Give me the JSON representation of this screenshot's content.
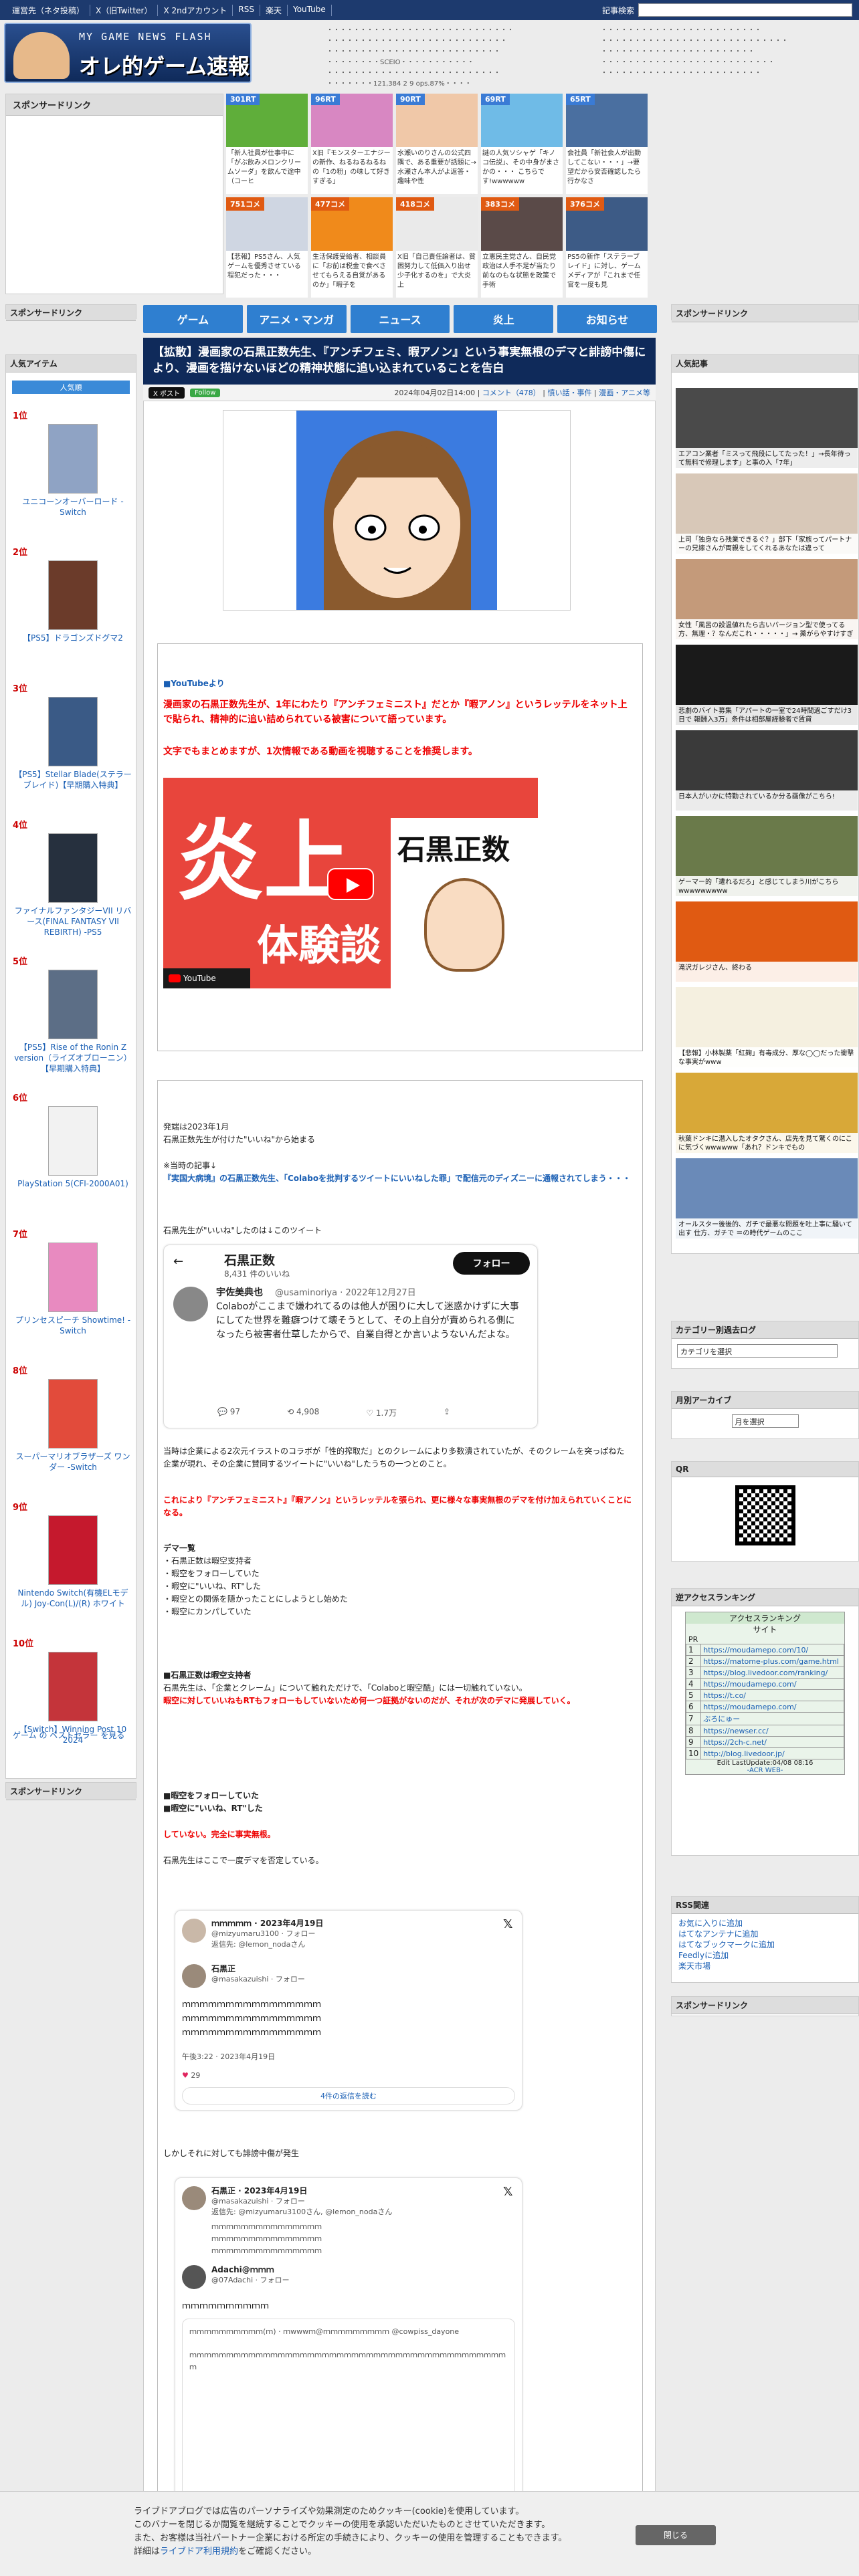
{
  "topbar": {
    "links": [
      "運営先（ネタ投稿）",
      "X（旧Twitter）",
      "X 2ndアカウント",
      "RSS",
      "楽天",
      "YouTube"
    ],
    "search_label": "記事検索"
  },
  "logo": {
    "sub": "MY GAME NEWS FLASH",
    "main": "オレ的ゲーム速報@JIN"
  },
  "headlinks": {
    "left": [
      "・・・・・・・・・・・・・・・・・・・・・・・・・・・・",
      "・・・・・・・・・・・・・・・・・・・・・・・・・・・",
      "・・・・・・・・・・・・・・・・・・・・・・・・・・",
      "・・・・・・・・SCEIO・・・・・・・・・・・",
      "・・・・・・・・・・・・・・・・・・・・・・・・・・",
      "・・・・・・・121,384 2 9 ops.87%・・・・"
    ],
    "right": [
      "・・・・・・・・・・・・・・・・・・・・・・・・",
      "・・・・・・・・・・・・・・・・・・・・・・・・・・・・",
      "・・・・・・・・・・・・・・・・・・・・・・・",
      "・・・・・・・・・・・・・・・・・・・・・・・・・・",
      "・・・・・・・・・・・・・・・・・・・・・・・・"
    ]
  },
  "sponsor_label": "スポンサードリンク",
  "tiles": [
    {
      "badge": "301RT",
      "red": false,
      "cap": "「新人社員が仕事中に「がぶ飲みメロンクリームソーダ」を飲んで途中（コーヒ",
      "color": "#5fae3a"
    },
    {
      "badge": "96RT",
      "red": false,
      "cap": "X旧『モンスターエナジーの新作、ねるねるねるねの「1の粉」の味して好きすぎる」",
      "color": "#d887c2"
    },
    {
      "badge": "90RT",
      "red": false,
      "cap": "水瀬いのりさんの公式四隅で、ある重要が話題に→水瀬さん本人がよ返答・趣味や性",
      "color": "#f0c8a8"
    },
    {
      "badge": "69RT",
      "red": false,
      "cap": "謎の人気ソシャゲ「キノコ伝説」、その中身がまさかの・・・ こちらです!wwwwww",
      "color": "#6fbbe7"
    },
    {
      "badge": "65RT",
      "red": false,
      "cap": "会社員「新社会人が出勤してこない・・・」→要望だから安否確認したら行かなさ",
      "color": "#4a6fa0"
    },
    {
      "badge": "751コメ",
      "red": true,
      "cap": "【悲報】PS5さん、人気ゲームを優秀させている程犯だった・・・",
      "color": "#cfd6e2"
    },
    {
      "badge": "477コメ",
      "red": true,
      "cap": "生活保護受給者、相談員に「お前は税金で食べさせてもらえる自覚があるのか」「暇子を",
      "color": "#f08a1b"
    },
    {
      "badge": "418コメ",
      "red": true,
      "cap": "X旧「自己責任論者は、貧困努力して低価入り出せ少子化するのを」で大炎上",
      "color": "#eaeaea"
    },
    {
      "badge": "383コメ",
      "red": true,
      "cap": "立憲民主党さん、自民党政治は人手不足が当たり前なのもな状態を政策で手術",
      "color": "#5a4a48"
    },
    {
      "badge": "376コメ",
      "red": true,
      "cap": "PS5の新作「ステラーブレイド」に対し、ゲームメディアが『これまで任官を一度も見",
      "color": "#3d5b86"
    }
  ],
  "nav": [
    "ゲーム",
    "アニメ・マンガ",
    "ニュース",
    "炎上",
    "お知らせ"
  ],
  "article": {
    "title": "【拡散】漫画家の石黒正数先生、『アンチフェミ、暇アノン』という事実無根のデマと誹謗中傷により、漫画を描けないほどの精神状態に追い込まれていることを告白",
    "post_btn": "X ポスト",
    "follow_btn": "Follow",
    "date": "2024年04月02日14:00",
    "comments": "コメント（478）",
    "cat1": "憤い話・事件",
    "cat2": "漫画・アニメ等",
    "yt_label": "■YouTubeより",
    "red1": "漫画家の石黒正数先生が、1年にわたり『アンチフェミニスト』だとか『暇アノン』というレッテルをネット上で貼られ、精神的に追い詰められている被害について語っています。",
    "red2": "文字でもまとめますが、1次情報である動画を視聴することを推奨します。",
    "video_big": "炎上",
    "video_sub": "体験談",
    "video_name": "石黒正数",
    "yt_brand": "YouTube",
    "p1a": "発端は2023年1月",
    "p1b": "石黒正数先生が付けた\"いいね\"から始まる",
    "p2a": "※当時の記事↓",
    "p2b": "『実国大病境』の石黒正数先生、「Colaboを批判するツイートにいいねした罪」で配信元のディズニーに通報されてしまう・・・",
    "p3": "石黒先生が\"いいね\"したのは↓このツイート",
    "tw1_name": "石黒正数",
    "tw1_follow": "フォロー",
    "tw1_likes": "8,431 件のいいね",
    "tw1_user": "宇佐美典也",
    "tw1_handle": "@usaminoriya · 2022年12月27日",
    "tw1_text": "Colaboがここまで嫌われてるのは他人が困りに大して迷惑かけずに大事にしてた世界を難癖つけて壊そうとして、その上自分が責められる側になったら被害者仕草したからで、自業自得とか言いようないんだよな。",
    "tw1_reply": "97",
    "tw1_rt": "4,908",
    "tw1_like": "1.7万",
    "p4": "当時は企業による2次元イラストのコラボが「性的搾取だ」とのクレームにより多数潰されていたが、そのクレームを突っぱねた企業が現れ、その企業に賛同するツイートに\"いいね\"したうちの一つとのこと。",
    "p5": "これにより『アンチフェミニスト』『暇アノン』というレッテルを張られ、更に様々な事実無根のデマを付け加えられていくことになる。",
    "demo_h": "デマ一覧",
    "demo": [
      "・石黒正数は暇空支持者",
      "・暇空をフォローしていた",
      "・暇空に\"いいね、RT\"した",
      "・暇空との関係を隠かったことにしようとし始めた",
      "・暇空にカンパしていた"
    ],
    "p6h": "■石黒正数は暇空支持者",
    "p6": "石黒先生は、「企業とクレーム」について触れただけで、「Colaboと暇空酷」には一切触れていない。",
    "p6red": "暇空に対していいねもRTもフォローもしていないため何一つ証拠がないのだが、それが次のデマに発展していく。",
    "p7h1": "■暇空をフォローしていた",
    "p7h2": "■暇空に\"いいね、RT\"した",
    "p7red": "していない。完全に事実無根。",
    "p8": "石黒先生はここで一度デマを否定している。",
    "tw2_name": "ｍｍｍｍｍ · 2023年4月19日",
    "tw2_handle": "@mizyumaru3100 · フォロー",
    "tw2_reply": "返信先: @lemon_nodaさん",
    "tw2_user": "石黒正",
    "tw2_uhandle": "@masakazuishi · フォロー",
    "tw2_lines": [
      "ｍｍｍｍｍｍｍｍｍｍｍｍｍｍｍｍ",
      "ｍｍｍｍｍｍｍｍｍｍｍｍｍｍｍｍ",
      "ｍｍｍｍｍｍｍｍｍｍｍｍｍｍｍｍ"
    ],
    "tw2_time": "午後3:22 · 2023年4月19日",
    "tw2_likes": "29",
    "tw2_more": "4件の返信を読む",
    "p9": "しかしそれに対しても誹謗中傷が発生",
    "tw3_name": "石黒正 · 2023年4月19日",
    "tw3_handle": "@masakazuishi · フォロー",
    "tw3_reply": "返信先: @mizyumaru3100さん, @lemon_nodaさん",
    "tw3_lines": [
      "ｍｍｍｍｍｍｍｍｍｍｍｍｍｍｍ",
      "ｍｍｍｍｍｍｍｍｍｍｍｍｍｍｍ",
      "ｍｍｍｍｍｍｍｍｍｍｍｍｍｍｍ"
    ],
    "tw3_user": "Adachi@ｍｍｍ",
    "tw3_uhandle": "@07Adachi · フォロー",
    "tw3_body": "ｍｍｍｍｍｍｍｍｍｍ",
    "tw3_quote": "ｍｍｍｍｍｍｍｍｍｍ(ｍ) · ｍwwwｍ@ｍｍｍｍｍｍｍｍｍ @cowpiss_dayone",
    "tw3_qtext": "ｍｍｍｍｍｍｍｍｍｍｍｍｍｍｍｍｍｍｍｍｍｍｍｍｍｍｍｍｍｍｍｍｍｍｍｍｍｍｍｍｍｍｍｍ"
  },
  "left": {
    "popular": "人気アイテム",
    "tab": "人気順",
    "ranks": [
      {
        "num": "1位",
        "tx": "ユニコーンオーバーロード -Switch",
        "color": "#8fa3c4"
      },
      {
        "num": "2位",
        "tx": "【PS5】ドラゴンズドグマ2",
        "color": "#6b3b2a"
      },
      {
        "num": "3位",
        "tx": "【PS5】Stellar Blade(ステラーブレイド)【早期購入特典】",
        "color": "#3a5a86"
      },
      {
        "num": "4位",
        "tx": "ファイナルファンタジーVII リバース(FINAL FANTASY VII REBIRTH) -PS5",
        "color": "#26303e"
      },
      {
        "num": "5位",
        "tx": "【PS5】Rise of the Ronin Z version（ライズオブローニン）【早期購入特典】",
        "color": "#5c6e86"
      },
      {
        "num": "6位",
        "tx": "PlayStation 5(CFI-2000A01)",
        "color": "#f2f2f2"
      },
      {
        "num": "7位",
        "tx": "プリンセスピーチ Showtime! -Switch",
        "color": "#e88ac0"
      },
      {
        "num": "8位",
        "tx": "スーパーマリオブラザーズ ワンダー -Switch",
        "color": "#e24b3b"
      },
      {
        "num": "9位",
        "tx": "Nintendo Switch(有機ELモデル) Joy-Con(L)/(R) ホワイト",
        "color": "#c5192d"
      },
      {
        "num": "10位",
        "tx": "【Switch】Winning Post 10 2024",
        "color": "#c4343a"
      }
    ],
    "more": "ゲーム の ベストセラー を見る"
  },
  "right": {
    "popular": "人気記事",
    "items": [
      {
        "cap": "エアコン業者「ミスって飛段にしてたった！」→長年待って無料で修理します」と事の入「7年」",
        "c": "#4a4a4a"
      },
      {
        "cap": "上司「独身なら残業できるぐ？」部下「家族ってパートナーの兄嫁さんが両親をしてくれるあなたは違って",
        "c": "#d8c8b8"
      },
      {
        "cap": "女性「風呂の設温値れたら古いバージョン型で使ってる方、無理・？なんだこれ・・・・・」→ 薬がらやすけすぎ",
        "c": "#c49a7a"
      },
      {
        "cap": "悲劇のバイト募集「アパートの一室で24時間過ごすだけ3日で 報酬入3万」条件は相部屋経験者で賃貸",
        "c": "#1a1a1a"
      },
      {
        "cap": "日本人がいかに特勤されているか分る画像がこちら!",
        "c": "#3a3a3a"
      },
      {
        "cap": "ゲーマー的「遭れるだろ」と感じてしまう川がこちらwwwwwwwww",
        "c": "#6a7a4a"
      },
      {
        "cap": "滝沢ガレジさん、終わる",
        "c": "#e05a12"
      },
      {
        "cap": "【悲報】小林製薬「紅麹」有毒成分、厚な◯◯だった衝撃な事実がwww",
        "c": "#f5f0e0"
      },
      {
        "cap": "秋葉ドンキに潜入したオタクさん、店先を見て驚くのにこに気づくwwwwww「あれ？ドンキでもの",
        "c": "#d8a838"
      },
      {
        "cap": "オールスター後後的、ガチで最悪な問題を吐上事に騒いて出す 仕方、ガチで ＝の時代ゲームのここ",
        "c": "#6a8ab8"
      }
    ],
    "cat_h": "カテゴリー別過去ログ",
    "cat_sel": "カテゴリを選択",
    "month_h": "月別アーカイブ",
    "month_sel": "月を選択",
    "qr_h": "QR",
    "rev_h": "逆アクセスランキング",
    "rev_table_h": "アクセスランキング",
    "rev_site": "サイト",
    "rev_pr": "PR",
    "rev_rows": [
      "https://moudamepo.com/10/",
      "https://matome-plus.com/game.html",
      "https://blog.livedoor.com/ranking/",
      "https://moudamepo.com/",
      "https://t.co/",
      "https://moudamepo.com/",
      "ぶろにゅー",
      "https://newser.cc/",
      "https://2ch-c.net/",
      "http://blog.livedoor.jp/"
    ],
    "rev_foot": "Edit LastUpdate:04/08 08:16",
    "rev_acr": "-ACR WEB-",
    "rss_h": "RSS関連",
    "rss_links": [
      "お気に入りに追加",
      "はてなアンテナに追加",
      "はてなブックマークに追加",
      "Feedlyに追加",
      "楽天市場"
    ]
  },
  "cookie": {
    "l1": "ライブドアブログでは広告のパーソナライズや効果測定のためクッキー(cookie)を使用しています。",
    "l2": "このバナーを閉じるか閲覧を継続することでクッキーの使用を承認いただいたものとさせていただきます。",
    "l3": "また、お客様は当社パートナー企業における所定の手続きにより、クッキーの使用を管理することもできます。",
    "l4a": "詳細は",
    "l4link": "ライブドア利用規約",
    "l4b": "をご確認ください。",
    "close": "閉じる"
  }
}
